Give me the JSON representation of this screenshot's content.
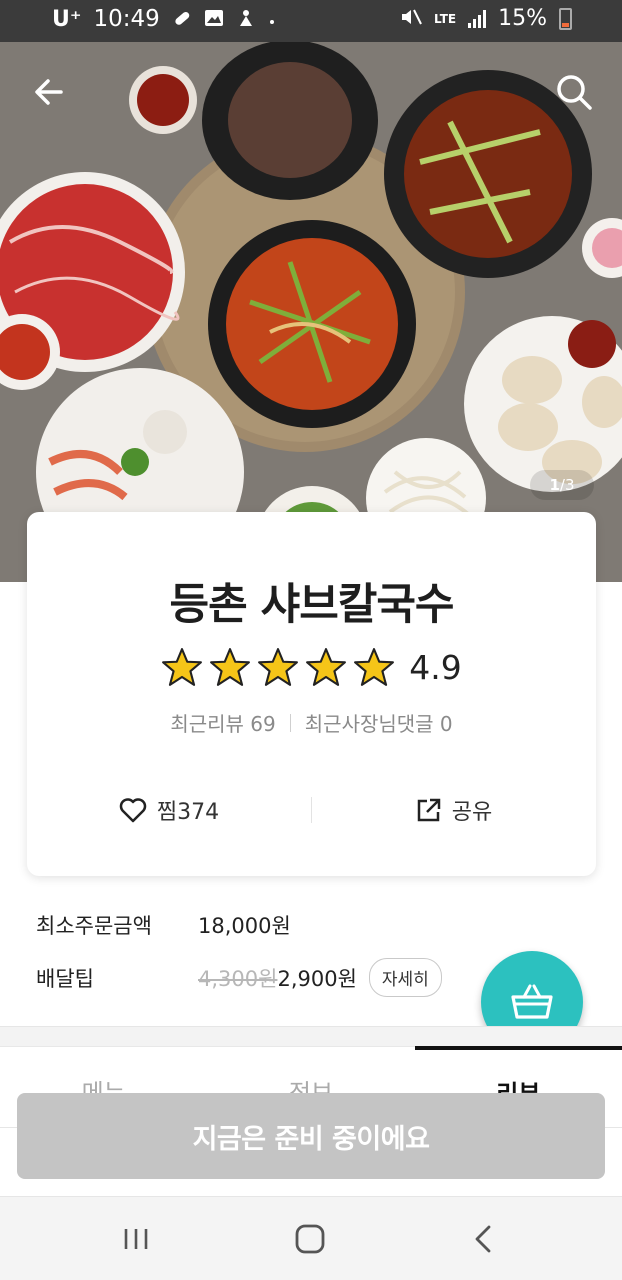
{
  "status_bar": {
    "carrier": "U⁺",
    "time": "10:49",
    "network": "LTE",
    "battery": "15%",
    "icons": [
      "pill-icon",
      "image-icon",
      "figure-icon",
      "dot-icon",
      "mute-icon",
      "signal-icon",
      "battery-icon"
    ]
  },
  "hero": {
    "page_current": "1",
    "page_total": "/3",
    "back_icon": "arrow-left-icon",
    "search_icon": "search-icon"
  },
  "store": {
    "name": "등촌 샤브칼국수",
    "rating": "4.9",
    "rating_stars": 5,
    "recent_review_label": "최근리뷰 69",
    "owner_reply_label": "최근사장님댓글 0"
  },
  "actions": {
    "like_label": "찜",
    "like_count": "374",
    "share_label": "공유"
  },
  "delivery": {
    "min_order_label": "최소주문금액",
    "min_order_value": "18,000원",
    "tip_label": "배달팁",
    "tip_original": "4,300원",
    "tip_value": "2,900원",
    "detail_button": "자세히"
  },
  "tabs": [
    {
      "label": "메뉴"
    },
    {
      "label": "정보"
    },
    {
      "label": "리뷰"
    }
  ],
  "banner": {
    "text": "지금은 준비 중이에요"
  },
  "colors": {
    "accent": "#2cc1bf",
    "star": "#f5c518",
    "banner": "#c4c4c4"
  }
}
